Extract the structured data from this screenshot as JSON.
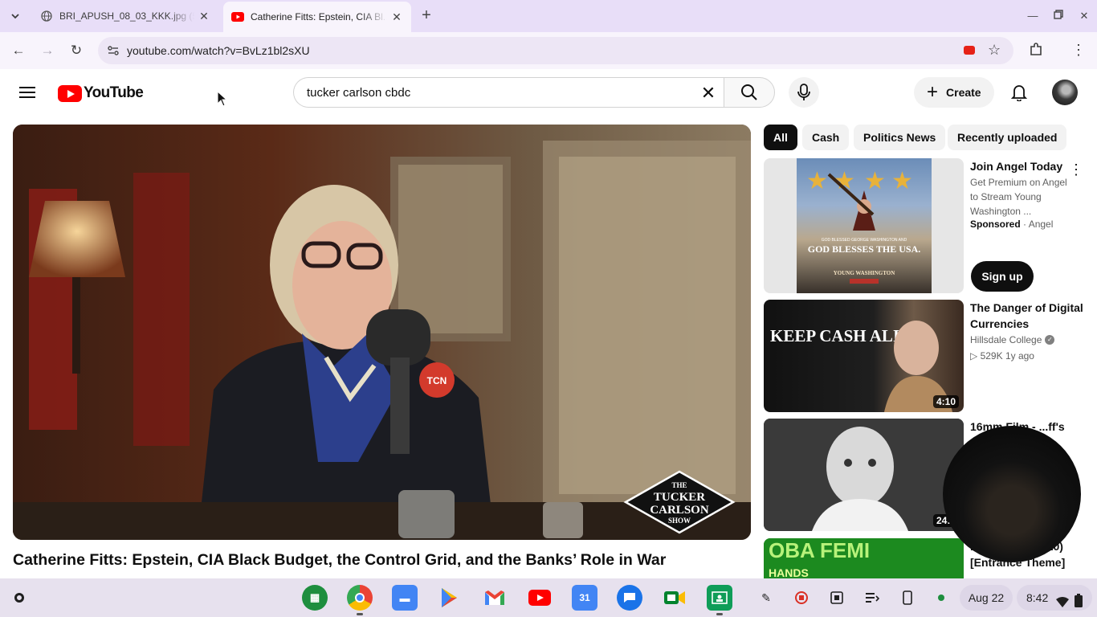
{
  "browser": {
    "tabs": [
      {
        "title": "BRI_APUSH_08_03_KKK.jpg (5...",
        "active": false
      },
      {
        "title": "Catherine Fitts: Epstein, CIA Bl...",
        "active": true
      }
    ],
    "url": "youtube.com/watch?v=BvLz1bl2sXU"
  },
  "youtube": {
    "logo_text": "YouTube",
    "search_value": "tucker carlson cbdc",
    "create_label": "Create"
  },
  "video": {
    "title": "Catherine Fitts: Epstein, CIA Black Budget, the Control Grid, and the Banks’ Role in War",
    "watermark": [
      "THE",
      "TUCKER",
      "CARLSON",
      "SHOW"
    ],
    "mic_tag": "TCN"
  },
  "chips": [
    "All",
    "Cash",
    "Politics News",
    "Recently uploaded"
  ],
  "ad": {
    "title": "Join Angel Today",
    "description": "Get Premium on Angel to Stream Young Washington ...",
    "sponsored": "Sponsored",
    "advertiser": "Angel",
    "cta": "Sign up",
    "thumb_text_top": "GOD BLESSED GEORGE WASHINGTON AND",
    "thumb_text_main": "GOD BLESSES THE USA.",
    "thumb_brand": "YOUNG WASHINGTON"
  },
  "related": [
    {
      "title": "The Danger of Digital Currencies",
      "channel": "Hillsdale College",
      "views": "529K",
      "age": "1y ago",
      "duration": "4:10",
      "thumb_text": "KEEP CASH ALIVE"
    },
    {
      "title": "16mm Film - ...ff's",
      "channel": "",
      "duration": "24:2"
    },
    {
      "title": "...s Of Fate (2020) [Entrance Theme]",
      "thumb_text": "OBA FEMI",
      "thumb_sub": "HANDS"
    }
  ],
  "shelf": {
    "date": "Aug 22",
    "time": "8:42",
    "apps": [
      "files-app",
      "chrome",
      "files",
      "play-store",
      "gmail",
      "youtube",
      "calendar",
      "messages",
      "meet",
      "classroom"
    ]
  },
  "colors": {
    "youtube_red": "#ff0000",
    "tabstrip": "#e8def8",
    "chip_active": "#0f0f0f"
  }
}
